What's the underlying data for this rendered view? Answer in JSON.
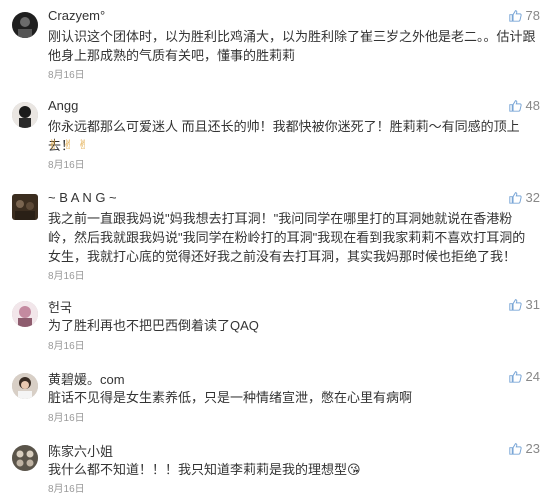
{
  "comments": [
    {
      "name": "Crazyem°",
      "likes": "78",
      "text": "刚认识这个团体时，以为胜利比鸡涌大，以为胜利除了崔三岁之外他是老二。。估计跟他身上那成熟的气质有关吧，懂事的胜莉莉",
      "date": "8月16日",
      "avatar_color": "#2b2b2b"
    },
    {
      "name": "Angg",
      "likes": "48",
      "text": "你永远都那么可爱迷人 而且还长的帅！我都快被你迷死了！胜莉莉～有同感的顶上去！",
      "emoji": "✌✌✌",
      "date": "8月16日",
      "avatar_color": "#3a3a3a"
    },
    {
      "name": "~ B A N G ~",
      "likes": "32",
      "text": "我之前一直跟我妈说\"妈我想去打耳洞！\"我问同学在哪里打的耳洞她就说在香港粉岭，然后我就跟我妈说\"我同学在粉岭打的耳洞\"我现在看到我家莉莉不喜欢打耳洞的女生，我就打心底的觉得还好我之前没有去打耳洞，其实我妈那时候也拒绝了我！",
      "date": "8月16日",
      "avatar_color": "#4a3a28"
    },
    {
      "name": "헌국",
      "likes": "31",
      "text": "为了胜利再也不把巴西倒着读了QAQ",
      "date": "8月16日",
      "avatar_color": "#c9a9b8"
    },
    {
      "name": "黄碧媛。com",
      "likes": "24",
      "text": "脏话不见得是女生素养低，只是一种情绪宣泄，憋在心里有病啊",
      "date": "8月16日",
      "avatar_color": "#8a7a6a"
    },
    {
      "name": "陈家六小姐",
      "likes": "23",
      "text": "我什么都不知道！！！我只知道李莉莉是我的理想型",
      "emoji": "😘",
      "date": "8月16日",
      "avatar_color": "#6b6458"
    }
  ],
  "colors": {
    "name": "#333333",
    "text": "#333333",
    "date": "#999999",
    "likes": "#888888",
    "separator": "#ececec"
  },
  "icons": {
    "like": "thumbs-up-icon"
  }
}
